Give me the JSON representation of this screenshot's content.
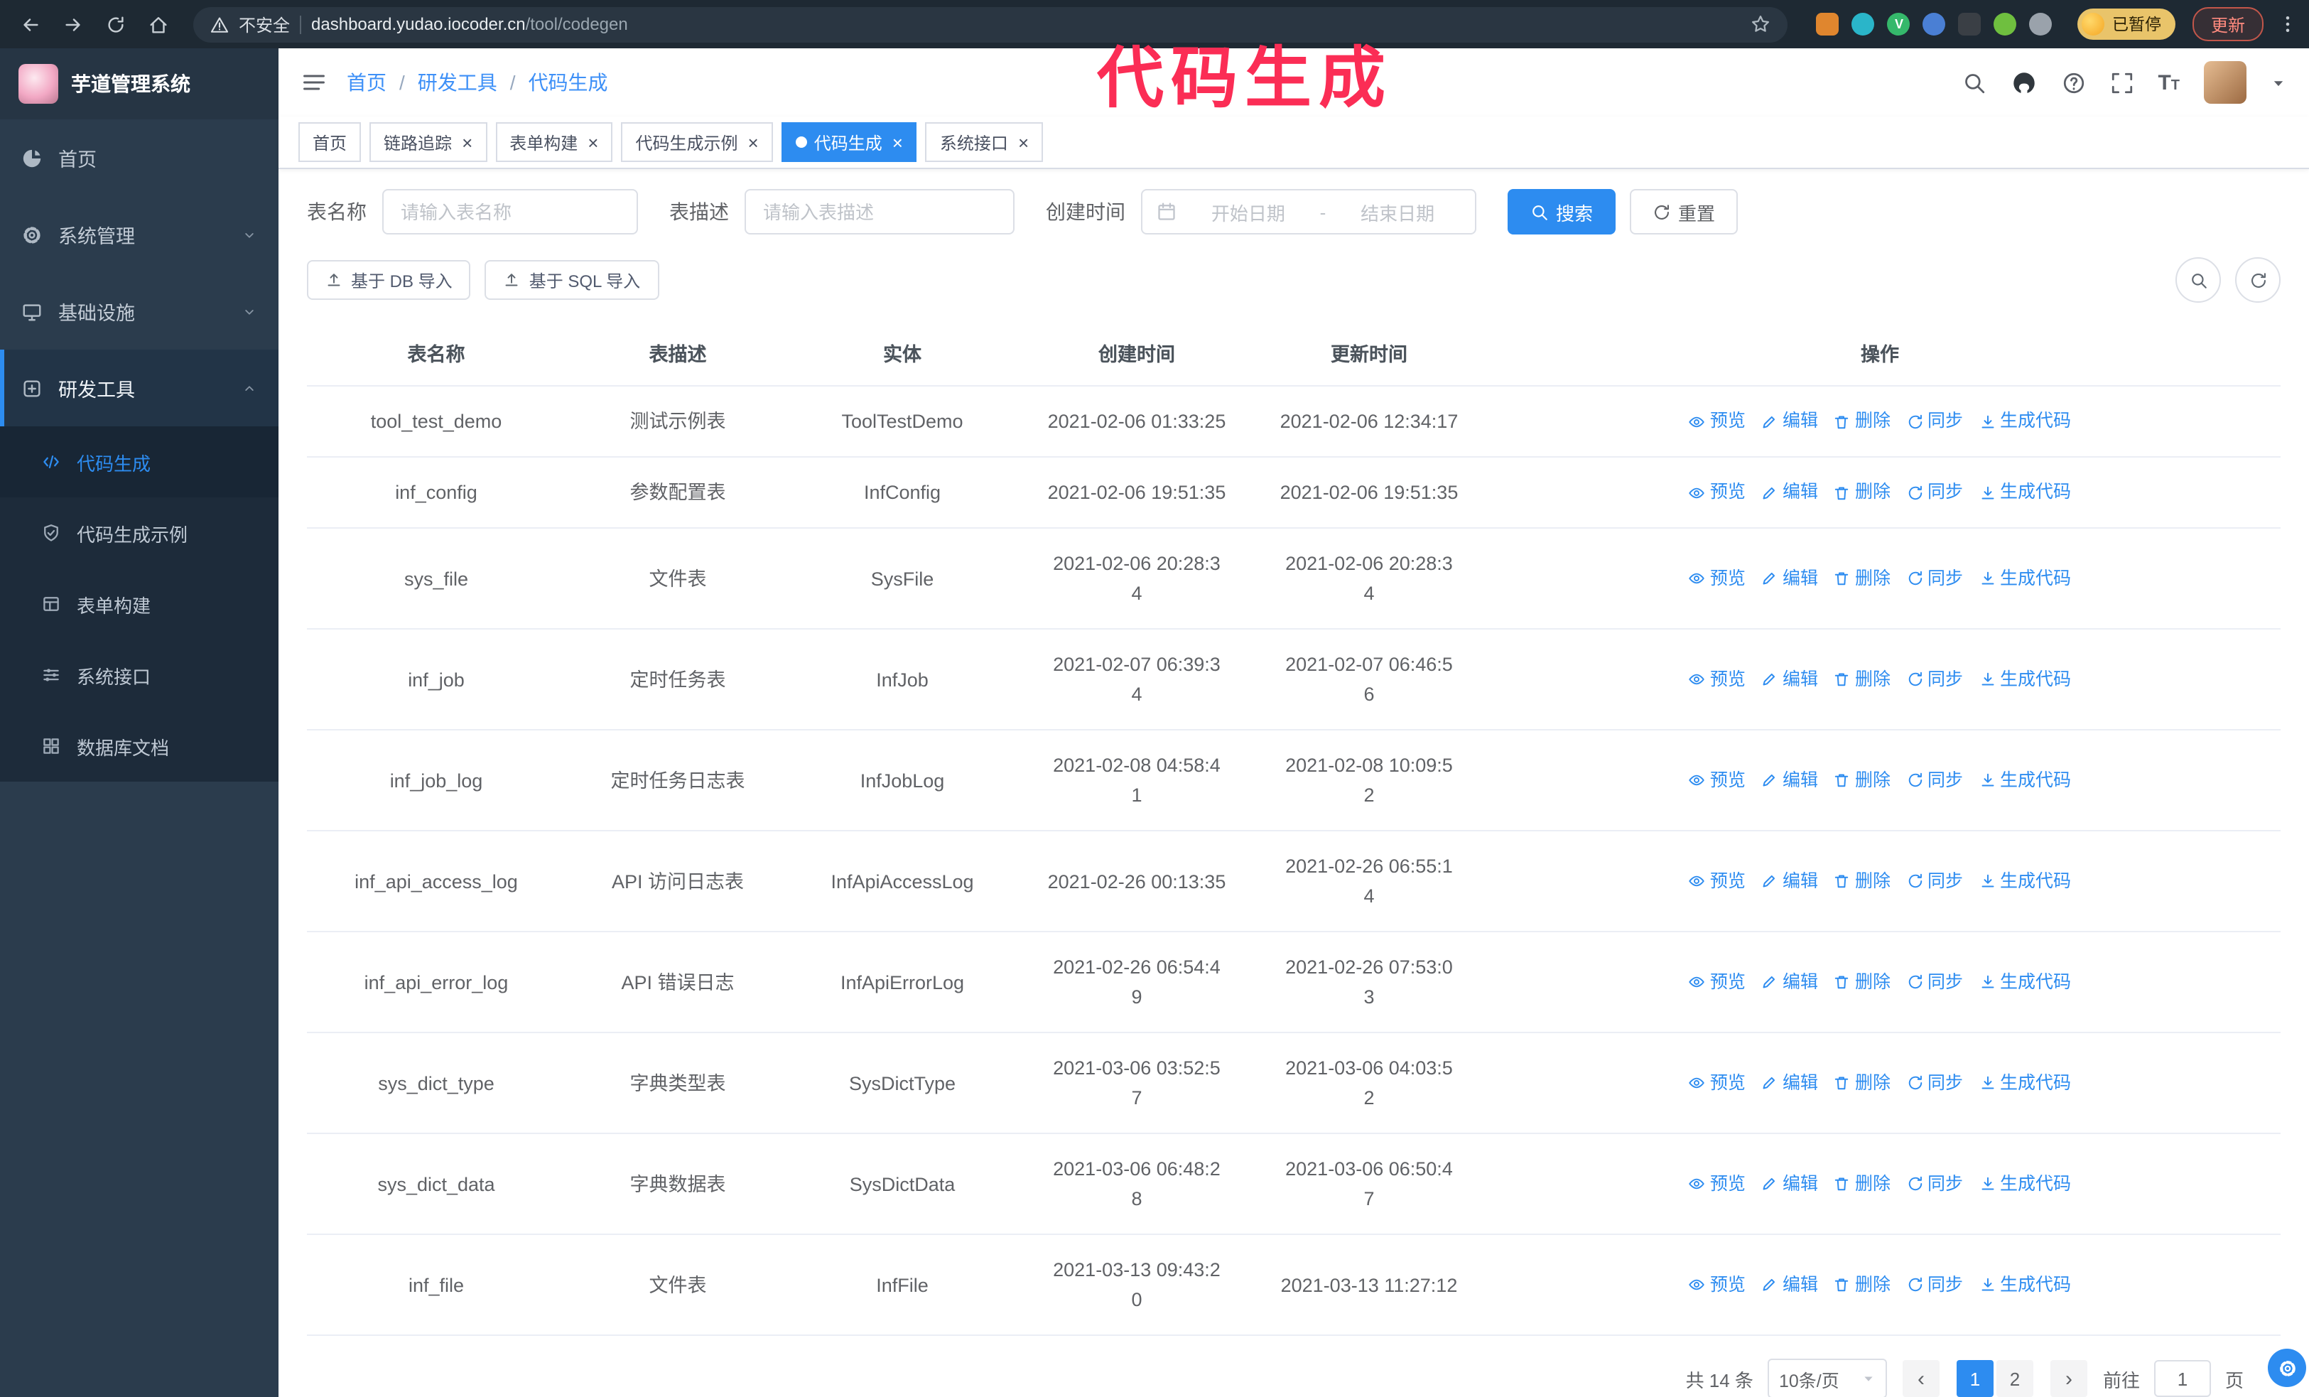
{
  "colors": {
    "accent": "#2d8cf0",
    "annotation": "#fb2d55",
    "sidebar_bg": "#2b3c4d",
    "submenu_bg": "#1d2b3a"
  },
  "browser": {
    "nav_icons": [
      "back",
      "forward",
      "reload",
      "home"
    ],
    "security_label": "不安全",
    "url_host": "dashboard.yudao.iocoder.cn",
    "url_path": "/tool/codegen",
    "extensions": [
      {
        "name": "extension-orange",
        "color": "#e0862e",
        "shape": "square"
      },
      {
        "name": "extension-teal",
        "color": "#2ab5c9",
        "shape": "circle"
      },
      {
        "name": "extension-green",
        "color": "#35b86b",
        "shape": "circle",
        "glyph": "V"
      },
      {
        "name": "extension-people",
        "color": "#4a7fd4",
        "shape": "circle"
      },
      {
        "name": "extension-dark",
        "color": "#3a3f45",
        "shape": "square"
      },
      {
        "name": "extension-leaf",
        "color": "#6fbf3f",
        "shape": "circle"
      },
      {
        "name": "extension-puzzle",
        "color": "#9aa2ab",
        "shape": "circle"
      }
    ],
    "paused_badge": "已暂停",
    "update_button": "更新"
  },
  "overlay": {
    "caption": "代码生成"
  },
  "sidebar": {
    "logo_title": "芋道管理系统",
    "items": [
      {
        "name": "home",
        "label": "首页",
        "icon": "dashboard"
      },
      {
        "name": "system-management",
        "label": "系统管理",
        "icon": "gear",
        "arrow": "down"
      },
      {
        "name": "infrastructure",
        "label": "基础设施",
        "icon": "infra",
        "arrow": "down"
      },
      {
        "name": "dev-tools",
        "label": "研发工具",
        "icon": "tools",
        "arrow": "up",
        "active": true,
        "expanded": true
      }
    ],
    "sub_items": [
      {
        "name": "code-generation",
        "label": "代码生成",
        "icon": "code",
        "active": true
      },
      {
        "name": "code-generation-example",
        "label": "代码生成示例",
        "icon": "shield"
      },
      {
        "name": "form-builder",
        "label": "表单构建",
        "icon": "form"
      },
      {
        "name": "system-api",
        "label": "系统接口",
        "icon": "api"
      },
      {
        "name": "database-doc",
        "label": "数据库文档",
        "icon": "db"
      }
    ]
  },
  "header": {
    "breadcrumb": [
      "首页",
      "研发工具",
      "代码生成"
    ]
  },
  "tabs": [
    {
      "name": "home",
      "label": "首页",
      "closable": false
    },
    {
      "name": "trace",
      "label": "链路追踪",
      "closable": true
    },
    {
      "name": "form-builder",
      "label": "表单构建",
      "closable": true
    },
    {
      "name": "codegen-example",
      "label": "代码生成示例",
      "closable": true
    },
    {
      "name": "codegen",
      "label": "代码生成",
      "closable": true,
      "active": true
    },
    {
      "name": "system-api",
      "label": "系统接口",
      "closable": true
    }
  ],
  "filters": {
    "table_name_label": "表名称",
    "table_name_placeholder": "请输入表名称",
    "table_desc_label": "表描述",
    "table_desc_placeholder": "请输入表描述",
    "create_time_label": "创建时间",
    "start_placeholder": "开始日期",
    "range_separator": "-",
    "end_placeholder": "结束日期",
    "search_button": "搜索",
    "reset_button": "重置"
  },
  "toolbar": {
    "import_db_button": "基于 DB 导入",
    "import_sql_button": "基于 SQL 导入"
  },
  "table": {
    "columns": [
      "表名称",
      "表描述",
      "实体",
      "创建时间",
      "更新时间",
      "操作"
    ],
    "ops": [
      {
        "name": "preview",
        "label": "预览",
        "icon": "eye"
      },
      {
        "name": "edit",
        "label": "编辑",
        "icon": "pencil"
      },
      {
        "name": "delete",
        "label": "删除",
        "icon": "trash"
      },
      {
        "name": "sync",
        "label": "同步",
        "icon": "sync"
      },
      {
        "name": "generate-code",
        "label": "生成代码",
        "icon": "download"
      }
    ],
    "rows": [
      {
        "name": "tool_test_demo",
        "desc": "测试示例表",
        "entity": "ToolTestDemo",
        "create_time": "2021-02-06 01:33:25",
        "update_time": "2021-02-06 12:34:17"
      },
      {
        "name": "inf_config",
        "desc": "参数配置表",
        "entity": "InfConfig",
        "create_time": "2021-02-06 19:51:35",
        "update_time": "2021-02-06 19:51:35"
      },
      {
        "name": "sys_file",
        "desc": "文件表",
        "entity": "SysFile",
        "create_time": "2021-02-06 20:28:3\n4",
        "update_time": "2021-02-06 20:28:3\n4"
      },
      {
        "name": "inf_job",
        "desc": "定时任务表",
        "entity": "InfJob",
        "create_time": "2021-02-07 06:39:3\n4",
        "update_time": "2021-02-07 06:46:5\n6"
      },
      {
        "name": "inf_job_log",
        "desc": "定时任务日志表",
        "entity": "InfJobLog",
        "create_time": "2021-02-08 04:58:4\n1",
        "update_time": "2021-02-08 10:09:5\n2"
      },
      {
        "name": "inf_api_access_log",
        "desc": "API 访问日志表",
        "entity": "InfApiAccessLog",
        "create_time": "2021-02-26 00:13:35",
        "update_time": "2021-02-26 06:55:1\n4"
      },
      {
        "name": "inf_api_error_log",
        "desc": "API 错误日志",
        "entity": "InfApiErrorLog",
        "create_time": "2021-02-26 06:54:4\n9",
        "update_time": "2021-02-26 07:53:0\n3"
      },
      {
        "name": "sys_dict_type",
        "desc": "字典类型表",
        "entity": "SysDictType",
        "create_time": "2021-03-06 03:52:5\n7",
        "update_time": "2021-03-06 04:03:5\n2"
      },
      {
        "name": "sys_dict_data",
        "desc": "字典数据表",
        "entity": "SysDictData",
        "create_time": "2021-03-06 06:48:2\n8",
        "update_time": "2021-03-06 06:50:4\n7"
      },
      {
        "name": "inf_file",
        "desc": "文件表",
        "entity": "InfFile",
        "create_time": "2021-03-13 09:43:2\n0",
        "update_time": "2021-03-13 11:27:12"
      }
    ]
  },
  "pagination": {
    "total_text": "共 14 条",
    "page_size": "10条/页",
    "pages": [
      "1",
      "2"
    ],
    "active_page": "1",
    "goto_label": "前往",
    "goto_value": "1",
    "page_unit": "页"
  }
}
